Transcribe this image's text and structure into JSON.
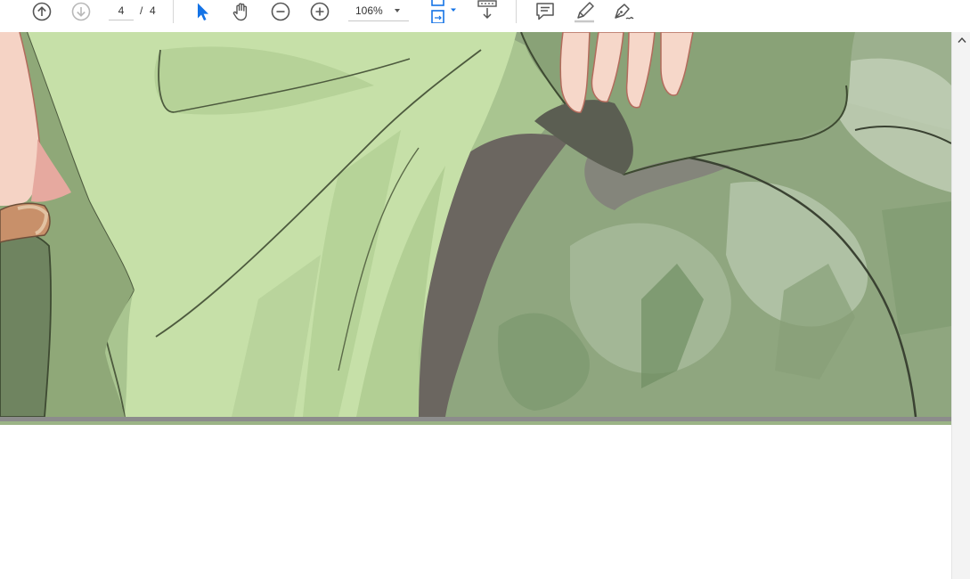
{
  "toolbar": {
    "previous_page_icon": "arrow-up-circle-icon",
    "next_page_icon": "arrow-down-circle-icon",
    "current_page": "4",
    "page_separator": "/",
    "total_pages": "4",
    "select_tool_icon": "cursor-arrow-icon",
    "hand_tool_icon": "hand-icon",
    "zoom_out_icon": "minus-circle-icon",
    "zoom_in_icon": "plus-circle-icon",
    "zoom_level": "106%",
    "page_display_icon": "page-fit-icon",
    "scroll_mode_icon": "scroll-down-icon",
    "comment_icon": "comment-icon",
    "highlight_icon": "highlighter-icon",
    "sign_icon": "pen-sign-icon"
  },
  "colors": {
    "accent": "#1473e6",
    "icon": "#555555",
    "icon_disabled": "#b8b8b8",
    "artwork_green": "#c5dea6",
    "artwork_moss": "#7e9a72"
  },
  "document": {
    "content": "illustration-page",
    "scroll_up_icon": "chevron-up-icon"
  }
}
